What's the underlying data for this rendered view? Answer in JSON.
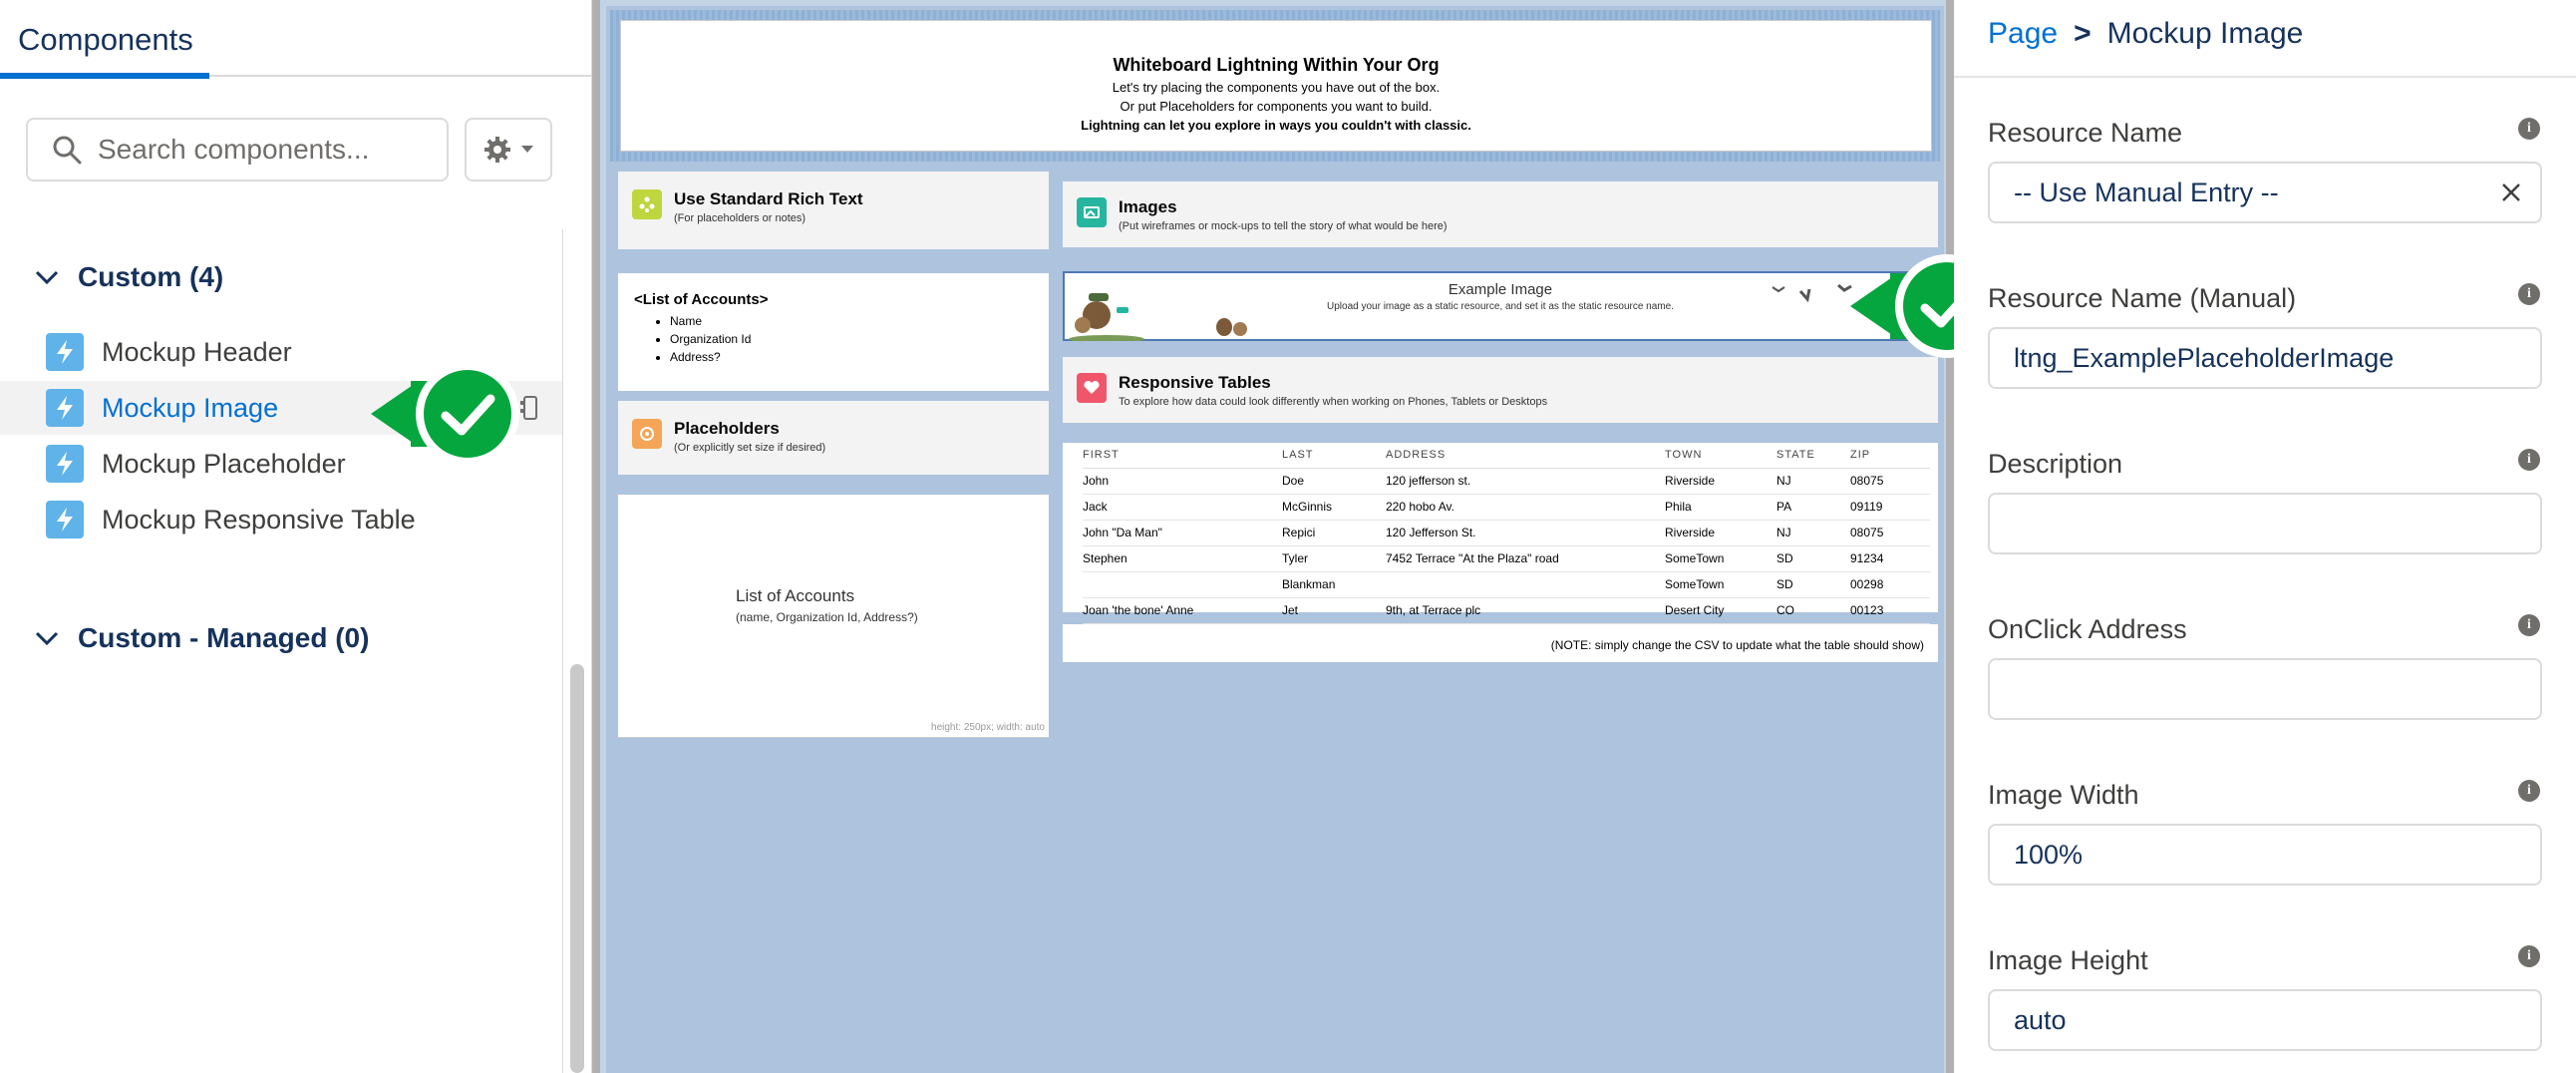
{
  "left_panel": {
    "tab_label": "Components",
    "search_placeholder": "Search components...",
    "custom_section": "Custom (4)",
    "custom_items": [
      {
        "label": "Mockup Header"
      },
      {
        "label": "Mockup Image"
      },
      {
        "label": "Mockup Placeholder"
      },
      {
        "label": "Mockup Responsive Table"
      }
    ],
    "managed_section": "Custom - Managed (0)"
  },
  "canvas": {
    "header": {
      "title": "Whiteboard Lightning Within Your Org",
      "line1": "Let's try placing the components you have out of the box.",
      "line2": "Or put Placeholders for components you want to build.",
      "line3": "Lightning can let you explore in ways you couldn't with classic."
    },
    "rich_text": {
      "title": "Use Standard Rich Text",
      "subtitle": "(For placeholders or notes)",
      "list_title": "<List of Accounts>",
      "list_items": [
        "Name",
        "Organization Id",
        "Address?"
      ]
    },
    "placeholders": {
      "title": "Placeholders",
      "subtitle": "(Or explicitly set size if desired)",
      "box_title": "List of Accounts",
      "box_subtitle": "(name, Organization Id, Address?)",
      "size_note": "height: 250px; width: auto"
    },
    "images": {
      "title": "Images",
      "subtitle": "(Put wireframes or mock-ups to tell the story of what would be here)",
      "example_title": "Example Image",
      "example_sub": "Upload your image as a static resource, and set it as the static resource name."
    },
    "tables": {
      "title": "Responsive Tables",
      "subtitle": "To explore how data could look differently when working on Phones, Tablets or Desktops",
      "columns": [
        "FIRST",
        "LAST",
        "ADDRESS",
        "TOWN",
        "STATE",
        "ZIP"
      ],
      "rows": [
        [
          "John",
          "Doe",
          "120 jefferson st.",
          "Riverside",
          "NJ",
          "08075"
        ],
        [
          "Jack",
          "McGinnis",
          "220 hobo Av.",
          "Phila",
          "PA",
          "09119"
        ],
        [
          "John \"Da Man\"",
          "Repici",
          "120 Jefferson St.",
          "Riverside",
          "NJ",
          "08075"
        ],
        [
          "Stephen",
          "Tyler",
          "7452 Terrace \"At the Plaza\" road",
          "SomeTown",
          "SD",
          "91234"
        ],
        [
          "",
          "Blankman",
          "",
          "SomeTown",
          "SD",
          "00298"
        ],
        [
          "Joan 'the bone' Anne",
          "Jet",
          "9th, at Terrace plc",
          "Desert City",
          "CO",
          "00123"
        ]
      ],
      "note": "(NOTE: simply change the CSV to update what the table should show)"
    }
  },
  "right_panel": {
    "breadcrumb_page": "Page",
    "breadcrumb_sep": ">",
    "breadcrumb_current": "Mockup Image",
    "fields": [
      {
        "label": "Resource Name",
        "value": "-- Use Manual Entry --"
      },
      {
        "label": "Resource Name (Manual)",
        "value": "ltng_ExamplePlaceholderImage"
      },
      {
        "label": "Description",
        "value": ""
      },
      {
        "label": "OnClick Address",
        "value": ""
      },
      {
        "label": "Image Width",
        "value": "100%"
      },
      {
        "label": "Image Height",
        "value": "auto"
      }
    ]
  },
  "colors": {
    "brand_blue": "#0070d2",
    "callout_green": "#04a63d",
    "canvas_bg": "#aec3dd"
  }
}
